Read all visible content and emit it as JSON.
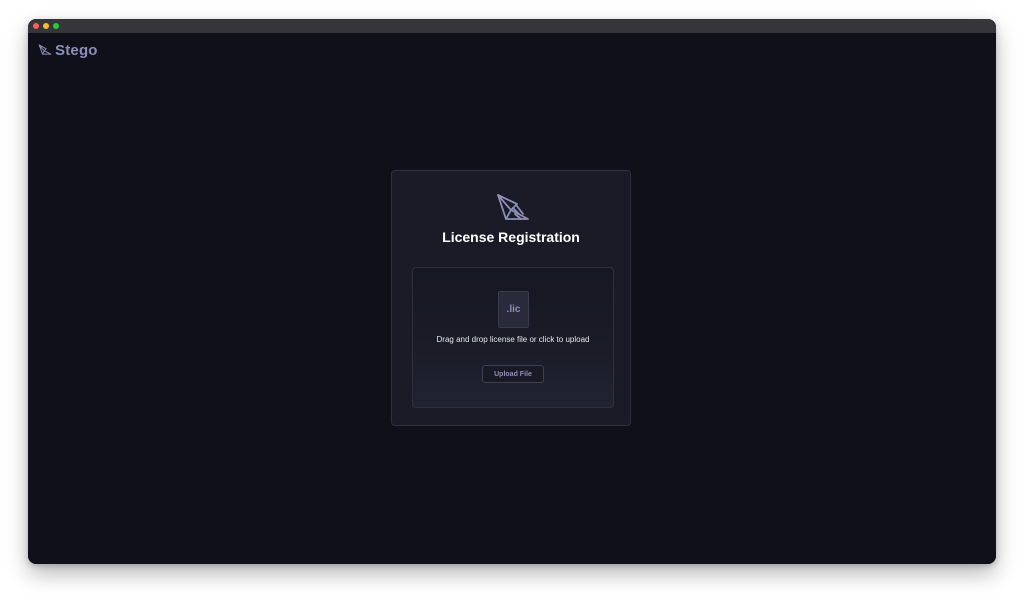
{
  "window": {
    "controls": [
      "close",
      "minimize",
      "maximize"
    ]
  },
  "brand": {
    "name": "Stego",
    "icon": "stego-logo-icon"
  },
  "card": {
    "title": "License Registration",
    "logo_icon": "stego-logo-icon",
    "dropzone": {
      "file_badge": ".lic",
      "instruction": "Drag and drop license file or click to upload",
      "upload_button": "Upload File"
    }
  },
  "colors": {
    "background": "#0f1019",
    "card": "#1a1b26",
    "accent": "#8e8fb8",
    "text": "#ffffff"
  }
}
